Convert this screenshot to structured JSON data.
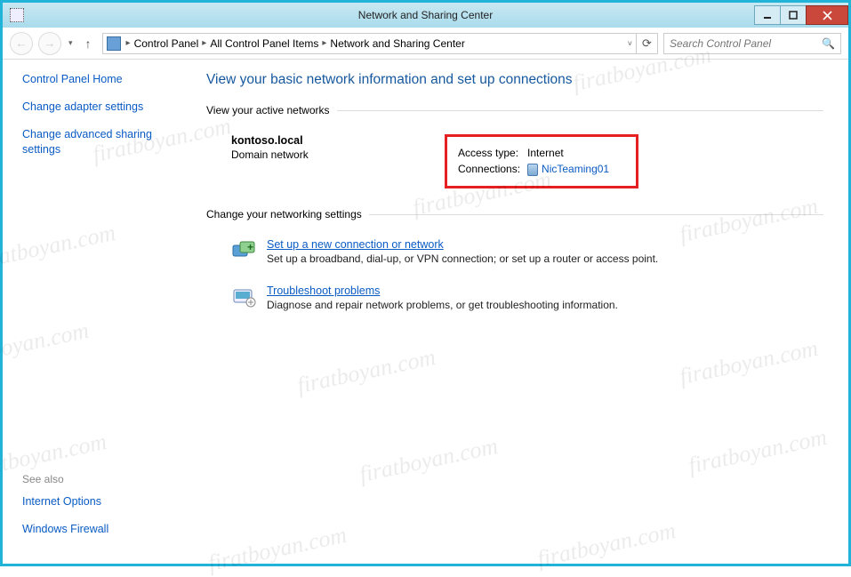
{
  "window": {
    "title": "Network and Sharing Center"
  },
  "breadcrumb": {
    "items": [
      "Control Panel",
      "All Control Panel Items",
      "Network and Sharing Center"
    ]
  },
  "search": {
    "placeholder": "Search Control Panel"
  },
  "sidebar": {
    "home": "Control Panel Home",
    "links": [
      "Change adapter settings",
      "Change advanced sharing settings"
    ],
    "seealso_label": "See also",
    "seealso": [
      "Internet Options",
      "Windows Firewall"
    ]
  },
  "main": {
    "heading": "View your basic network information and set up connections",
    "section_active": "View your active networks",
    "network": {
      "name": "kontoso.local",
      "type": "Domain network",
      "access_label": "Access type:",
      "access_value": "Internet",
      "conn_label": "Connections:",
      "conn_value": "NicTeaming01"
    },
    "section_change": "Change your networking settings",
    "tasks": [
      {
        "title": "Set up a new connection or network",
        "desc": "Set up a broadband, dial-up, or VPN connection; or set up a router or access point."
      },
      {
        "title": "Troubleshoot problems",
        "desc": "Diagnose and repair network problems, or get troubleshooting information."
      }
    ]
  },
  "watermark": "firatboyan.com"
}
